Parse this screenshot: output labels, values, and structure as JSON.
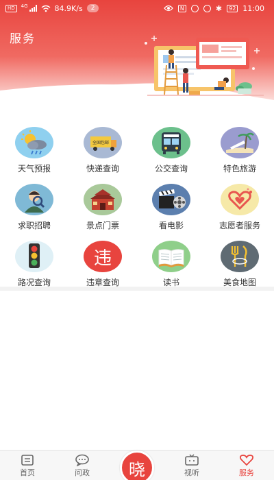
{
  "status_bar": {
    "hd": "HD",
    "network": "4G",
    "speed": "84.9K/s",
    "notifications": "2",
    "nfc": "N",
    "battery": "92",
    "time": "11:00"
  },
  "header": {
    "title": "服务",
    "bg_color_top": "#e8443e",
    "bg_color_bottom": "#fbd9d6"
  },
  "services": [
    {
      "label": "天气预报",
      "icon": "weather-icon"
    },
    {
      "label": "快递查询",
      "icon": "delivery-truck-icon"
    },
    {
      "label": "公交查询",
      "icon": "bus-icon"
    },
    {
      "label": "特色旅游",
      "icon": "travel-icon"
    },
    {
      "label": "求职招聘",
      "icon": "job-icon"
    },
    {
      "label": "景点门票",
      "icon": "gate-icon"
    },
    {
      "label": "看电影",
      "icon": "film-clapper-icon"
    },
    {
      "label": "志愿者服务",
      "icon": "heart-hands-icon"
    },
    {
      "label": "路况查询",
      "icon": "traffic-light-icon"
    },
    {
      "label": "违章查询",
      "icon": "violation-icon"
    },
    {
      "label": "读书",
      "icon": "book-icon"
    },
    {
      "label": "美食地图",
      "icon": "cutlery-icon"
    }
  ],
  "delivery_truck_text": "全国包邮",
  "violation_char": "违",
  "tabbar": {
    "items": [
      {
        "label": "首页",
        "icon": "home-book-icon"
      },
      {
        "label": "问政",
        "icon": "chat-bubble-icon"
      },
      {
        "label": "视听",
        "icon": "tv-icon"
      },
      {
        "label": "服务",
        "icon": "heart-icon"
      }
    ],
    "center_char": "晓",
    "active_color": "#e8443e"
  }
}
